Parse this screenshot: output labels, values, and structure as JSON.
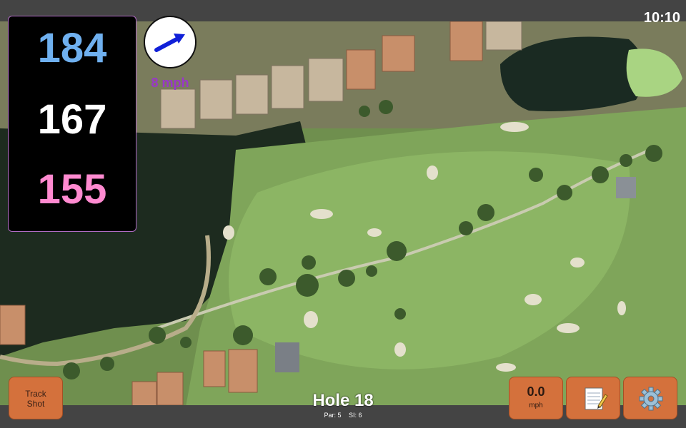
{
  "status": {
    "time": "10:10"
  },
  "yardage": {
    "back": "184",
    "middle": "167",
    "front": "155"
  },
  "wind": {
    "speed": "8 mph"
  },
  "buttons": {
    "track_shot_line1": "Track",
    "track_shot_line2": "Shot",
    "speed_value": "0.0",
    "speed_unit": "mph"
  },
  "hole": {
    "title": "Hole 18",
    "par": "Par: 5",
    "si": "SI: 6"
  },
  "icons": {
    "wind": "arrow-icon",
    "notes": "notepad-icon",
    "settings": "gear-icon"
  },
  "colors": {
    "back": "#6fb0ef",
    "middle": "#ffffff",
    "front": "#ff8ad0",
    "button": "#d4713c",
    "wind_text": "#9a36c9"
  }
}
